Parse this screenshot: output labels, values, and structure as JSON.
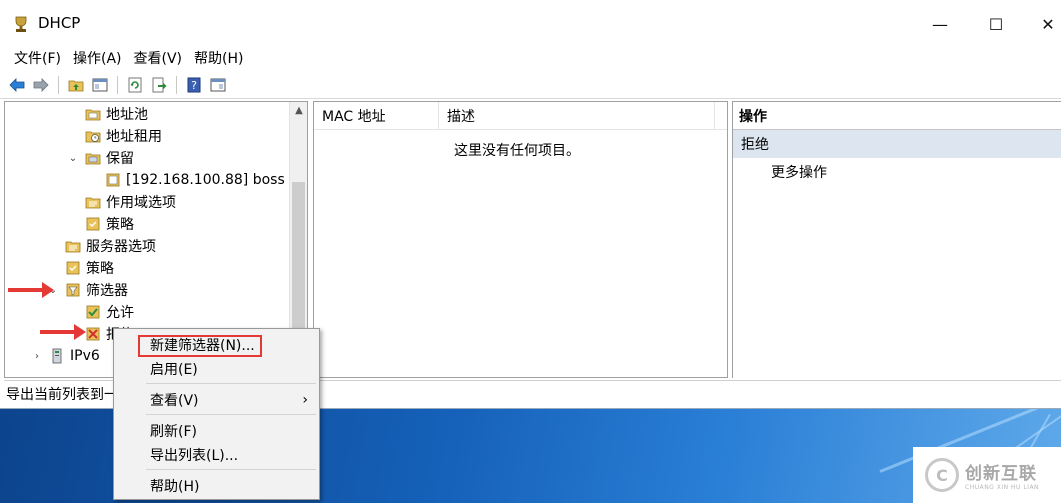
{
  "window": {
    "title": "DHCP",
    "minimize_glyph": "—",
    "maximize_glyph": "☐",
    "close_glyph": "✕"
  },
  "menubar": {
    "file": "文件(F)",
    "action": "操作(A)",
    "view": "查看(V)",
    "help": "帮助(H)"
  },
  "toolbar": {
    "icons": [
      "back-arrow-icon",
      "forward-arrow-icon",
      "up-folder-icon",
      "show-hide-tree-icon",
      "refresh-icon",
      "export-list-icon",
      "help-icon",
      "properties-icon"
    ]
  },
  "tree": {
    "items": [
      {
        "label": "地址池",
        "icon": "address-pool-icon"
      },
      {
        "label": "地址租用",
        "icon": "address-lease-icon"
      },
      {
        "label": "保留",
        "icon": "reservation-folder-icon",
        "expanded": true
      },
      {
        "label": "[192.168.100.88] boss",
        "icon": "reservation-entry-icon"
      },
      {
        "label": "作用域选项",
        "icon": "scope-options-icon"
      },
      {
        "label": "策略",
        "icon": "policy-icon"
      },
      {
        "label": "服务器选项",
        "icon": "server-options-icon"
      },
      {
        "label": "策略",
        "icon": "policy-icon"
      },
      {
        "label": "筛选器",
        "icon": "filter-icon",
        "expanded": true
      },
      {
        "label": "允许",
        "icon": "allow-icon"
      },
      {
        "label": "拒绝",
        "icon": "deny-icon",
        "selected": true
      },
      {
        "label": "IPv6",
        "icon": "ipv6-icon",
        "expanded": false
      }
    ]
  },
  "list": {
    "columns": [
      "MAC 地址",
      "描述"
    ],
    "empty_text": "这里没有任何项目。"
  },
  "actions": {
    "header": "操作",
    "section": "拒绝",
    "more": "更多操作"
  },
  "statusbar": {
    "text": "导出当前列表到一"
  },
  "context_menu": {
    "items": [
      {
        "label": "新建筛选器(N)...",
        "highlighted": true
      },
      {
        "label": "启用(E)"
      },
      {
        "label": "查看(V)",
        "submenu": true
      },
      {
        "label": "刷新(F)"
      },
      {
        "label": "导出列表(L)..."
      },
      {
        "label": "帮助(H)"
      }
    ],
    "submenu_glyph": "›"
  },
  "watermark": {
    "logo_letter": "C",
    "main": "创新互联",
    "sub": "CHUANG XIN HU LIAN"
  },
  "colors": {
    "accent_red": "#e53935",
    "desktop_blue": "#1560b8",
    "actions_section_bg": "#dde6f0"
  }
}
